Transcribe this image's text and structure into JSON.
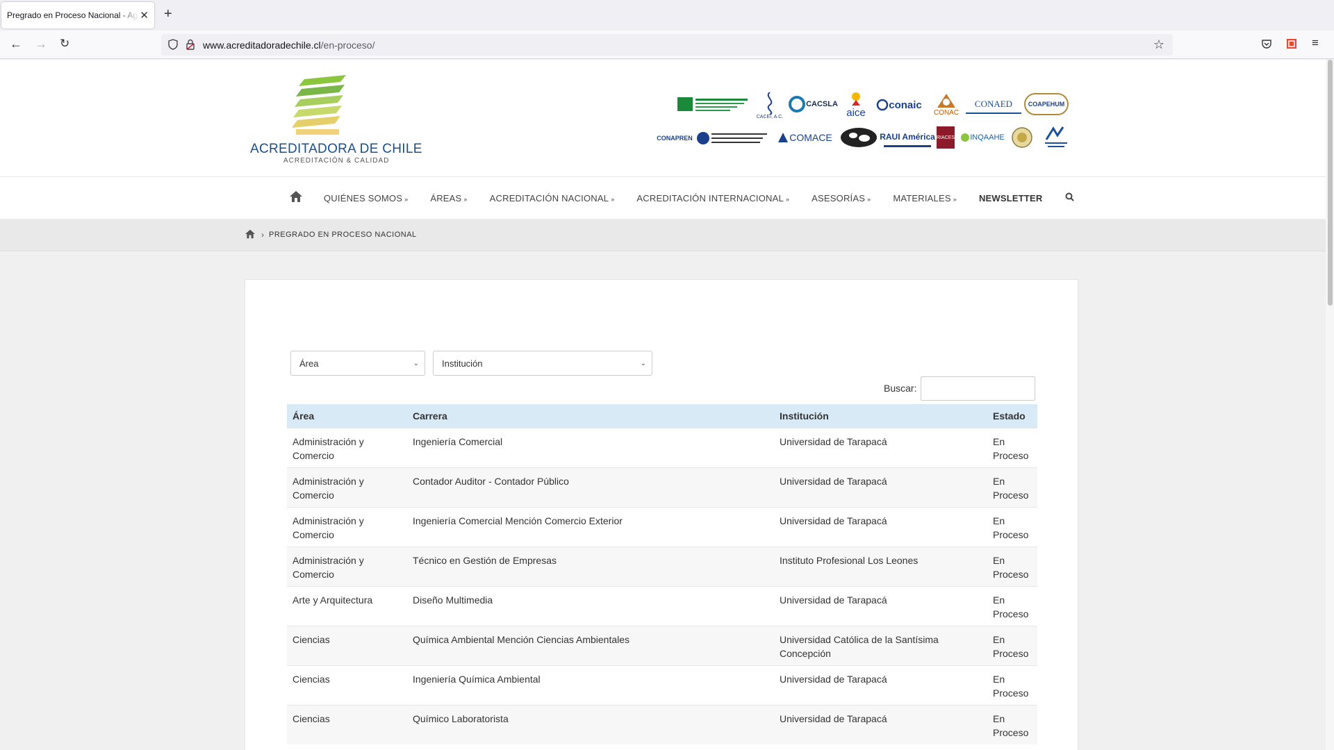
{
  "browser": {
    "tab_title": "Pregrado en Proceso Nacional - Agencia Acreditadora de Chile",
    "url_host": "www.acreditadoradechile.cl",
    "url_path": "/en-proceso/"
  },
  "site": {
    "logo_title": "ACREDITADORA DE CHILE",
    "logo_subtitle": "ACREDITACIÓN & CALIDAD",
    "partners": [
      "CACEI, A.C.",
      "CACSLA",
      "aice",
      "conaic",
      "CONAC",
      "CONAED",
      "COAPEHUM",
      "CONAPREN",
      "COMACE",
      "RAUI América",
      "RIACES",
      "INQAAHE"
    ]
  },
  "nav": {
    "items": [
      {
        "label": "QUIÉNES SOMOS",
        "chev": "»"
      },
      {
        "label": "ÁREAS",
        "chev": "»"
      },
      {
        "label": "ACREDITACIÓN NACIONAL",
        "chev": "»"
      },
      {
        "label": "ACREDITACIÓN INTERNACIONAL",
        "chev": "»"
      },
      {
        "label": "ASESORÍAS",
        "chev": "»"
      },
      {
        "label": "MATERIALES",
        "chev": "»"
      },
      {
        "label": "NEWSLETTER",
        "chev": ""
      }
    ]
  },
  "breadcrumb": {
    "sep": "›",
    "current": "PREGRADO EN PROCESO NACIONAL"
  },
  "filters": {
    "area_label": "Área",
    "institucion_label": "Institución",
    "search_label": "Buscar:"
  },
  "table": {
    "headers": [
      "Área",
      "Carrera",
      "Institución",
      "Estado"
    ],
    "rows": [
      [
        "Administración y Comercio",
        "Ingeniería Comercial",
        "Universidad de Tarapacá",
        "En Proceso"
      ],
      [
        "Administración y Comercio",
        "Contador Auditor - Contador Público",
        "Universidad de Tarapacá",
        "En Proceso"
      ],
      [
        "Administración y Comercio",
        "Ingeniería Comercial Mención Comercio Exterior",
        "Universidad de Tarapacá",
        "En Proceso"
      ],
      [
        "Administración y Comercio",
        "Técnico en Gestión de Empresas",
        "Instituto Profesional Los Leones",
        "En Proceso"
      ],
      [
        "Arte y Arquitectura",
        "Diseño Multimedia",
        "Universidad de Tarapacá",
        "En Proceso"
      ],
      [
        "Ciencias",
        "Química Ambiental Mención Ciencias Ambientales",
        "Universidad Católica de la Santísima Concepción",
        "En Proceso"
      ],
      [
        "Ciencias",
        "Ingeniería Química Ambiental",
        "Universidad de Tarapacá",
        "En Proceso"
      ],
      [
        "Ciencias",
        "Químico Laboratorista",
        "Universidad de Tarapacá",
        "En Proceso"
      ]
    ]
  }
}
